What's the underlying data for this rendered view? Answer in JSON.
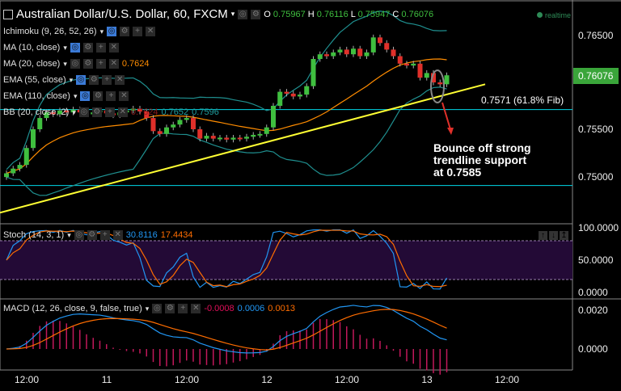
{
  "header": {
    "title": "Australian Dollar/U.S. Dollar, 60, FXCM",
    "ohlc": {
      "o_label": "O",
      "o": "0.75967",
      "h_label": "H",
      "h": "0.76116",
      "l_label": "L",
      "l": "0.75947",
      "c_label": "C",
      "c": "0.76076"
    },
    "realtime": "realtime"
  },
  "indicators": [
    {
      "label": "Ichimoku (9, 26, 52, 26)",
      "visible": true,
      "value": ""
    },
    {
      "label": "MA (10, close)",
      "visible": true,
      "value": ""
    },
    {
      "label": "MA (20, close)",
      "visible": false,
      "value": "0.7624"
    },
    {
      "label": "EMA (55, close)",
      "visible": true,
      "value": ""
    },
    {
      "label": "EMA (110, close)",
      "visible": true,
      "value": ""
    },
    {
      "label": "BB (20, close, 2)",
      "visible": false,
      "values": [
        "0.7624",
        "0.7652",
        "0.7596"
      ]
    }
  ],
  "stoch": {
    "label": "Stoch (14, 3, 1)",
    "k": "30.8116",
    "d": "17.4434"
  },
  "macd": {
    "label": "MACD (12, 26, close, 9, false, true)",
    "hist": "-0.0008",
    "macd": "0.0006",
    "signal": "0.0013"
  },
  "price_axis": [
    "0.76500",
    "0.75500",
    "0.75000"
  ],
  "current_price": "0.76076",
  "stoch_axis": [
    "100.0000",
    "50.0000",
    "0.0000"
  ],
  "macd_axis": [
    "0.0020",
    "0.0000"
  ],
  "time_axis": [
    "12:00",
    "11",
    "12:00",
    "12",
    "12:00",
    "13",
    "12:00"
  ],
  "annotations": {
    "fib_label": "0.7571 (61.8% Fib)",
    "fib_level": 0.7571,
    "lower_level": 0.749,
    "callout": [
      "Bounce off strong",
      "trendline support",
      "at 0.7585"
    ],
    "trendline": {
      "from_price": 0.7461,
      "to_price": 0.7598
    }
  },
  "colors": {
    "up": "#3fbf3f",
    "down": "#e0302a",
    "ma": "#ff8c00",
    "bb": "#1f8f8f",
    "level": "#00d8e8",
    "trend": "#ffff33",
    "stoch_k": "#2196f3",
    "stoch_d": "#ff6d00",
    "hist": "#c2185b",
    "band": "#230a36"
  },
  "chart_data": {
    "type": "candlestick",
    "interval": "60",
    "closes": [
      0.7503,
      0.7508,
      0.7512,
      0.753,
      0.755,
      0.7562,
      0.7568,
      0.7566,
      0.757,
      0.7568,
      0.7571,
      0.7568,
      0.7566,
      0.7568,
      0.757,
      0.7567,
      0.7565,
      0.7568,
      0.757,
      0.7572,
      0.7569,
      0.7562,
      0.7548,
      0.7545,
      0.7552,
      0.7555,
      0.756,
      0.7562,
      0.755,
      0.754,
      0.7543,
      0.754,
      0.7541,
      0.7539,
      0.7541,
      0.754,
      0.7542,
      0.7544,
      0.7545,
      0.7552,
      0.7575,
      0.759,
      0.7588,
      0.7585,
      0.7587,
      0.7596,
      0.7625,
      0.763,
      0.7628,
      0.7632,
      0.7635,
      0.763,
      0.7636,
      0.7628,
      0.7632,
      0.7648,
      0.7642,
      0.7635,
      0.7628,
      0.762,
      0.7618,
      0.762,
      0.7605,
      0.761,
      0.76,
      0.7598,
      0.76076
    ],
    "price_range": [
      0.744,
      0.768
    ]
  }
}
